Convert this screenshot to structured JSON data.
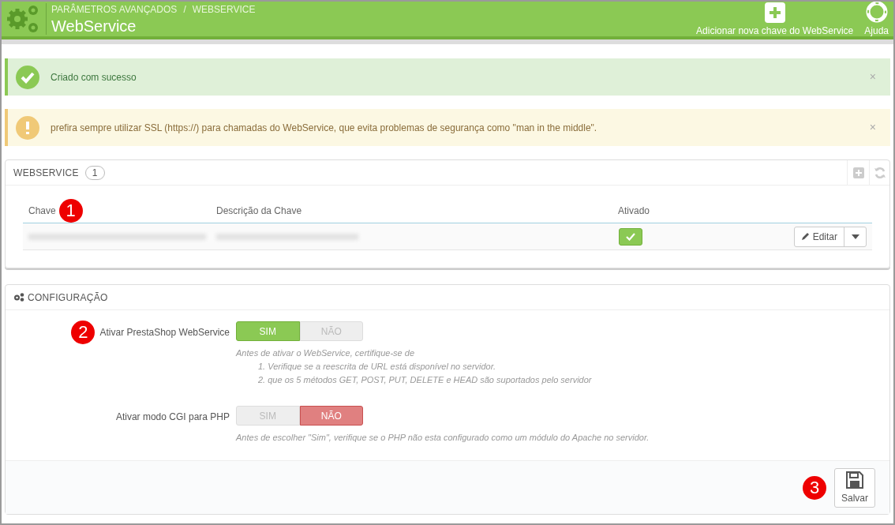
{
  "header": {
    "breadcrumb": [
      "PARÂMETROS AVANÇADOS",
      "WEBSERVICE"
    ],
    "breadcrumb_separator": "/",
    "title": "WebService",
    "actions": [
      {
        "kind": "add",
        "label": "Adicionar nova chave do WebService"
      },
      {
        "kind": "help",
        "label": "Ajuda"
      }
    ]
  },
  "alerts": [
    {
      "kind": "success",
      "text": "Criado com sucesso",
      "close": "×"
    },
    {
      "kind": "warning",
      "text": "prefira sempre utilizar SSL (https://) para chamadas do WebService, que evita problemas de segurança como \"man in the middle\".",
      "close": "×"
    }
  ],
  "webservice_panel": {
    "title": "WEBSERVICE",
    "count": "1",
    "columns": [
      "Chave",
      "Descrição da Chave",
      "Ativado"
    ],
    "rows": [
      {
        "enabled": true,
        "edit_label": "Editar"
      }
    ]
  },
  "config_panel": {
    "title": "CONFIGURAÇÃO",
    "fields": [
      {
        "label": "Ativar PrestaShop WebService",
        "options": [
          {
            "kind": "yes",
            "label": "SIM",
            "selected": true
          },
          {
            "kind": "no",
            "label": "NÃO",
            "selected": false
          }
        ],
        "help": [
          "Antes de ativar o WebService, certifique-se de",
          "1. Verifique se a reescrita de URL está disponível no servidor.",
          "2. que os 5 métodos GET, POST, PUT, DELETE e HEAD são suportados pelo servidor"
        ]
      },
      {
        "label": "Ativar modo CGI para PHP",
        "options": [
          {
            "kind": "yes",
            "label": "SIM",
            "selected": false
          },
          {
            "kind": "no",
            "label": "NÃO",
            "selected": true
          }
        ],
        "help": [
          "Antes de escolher \"Sim\", verifique se o PHP não esta configurado como um módulo do Apache no servidor."
        ]
      }
    ],
    "save_label": "Salvar"
  },
  "callouts": [
    "1",
    "2",
    "3"
  ]
}
